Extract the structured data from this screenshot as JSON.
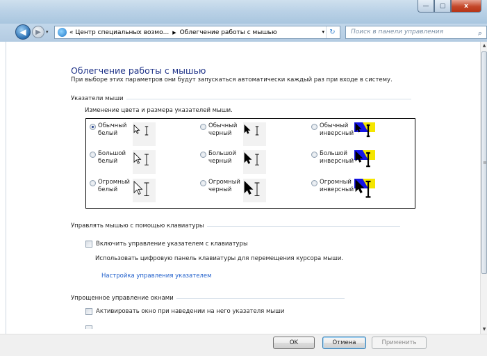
{
  "window": {
    "minimize_glyph": "—",
    "maximize_glyph": "▢",
    "close_glyph": "x"
  },
  "nav": {
    "back_glyph": "◀",
    "forward_glyph": "▶",
    "dropdown_glyph": "▾",
    "breadcrumb_prefix": "«",
    "breadcrumb": [
      "Центр специальных возмо...",
      "Облегчение работы с мышью"
    ],
    "breadcrumb_separator": "▶",
    "address_dropdown_glyph": "▾",
    "refresh_glyph": "↻",
    "search_placeholder": "Поиск в панели управления",
    "search_glyph": "⌕"
  },
  "page": {
    "title": "Облегчение работы с мышью",
    "subtitle": "При выборе этих параметров они будут запускаться автоматически каждый раз при входе в систему."
  },
  "pointers": {
    "section_title": "Указатели мыши",
    "description": "Изменение цвета и размера указателей мыши.",
    "schemes": [
      {
        "line1": "Обычный",
        "line2": "белый",
        "selected": true,
        "style": "white",
        "size": "normal"
      },
      {
        "line1": "Обычный",
        "line2": "черный",
        "selected": false,
        "style": "black",
        "size": "normal"
      },
      {
        "line1": "Обычный",
        "line2": "инверсный",
        "selected": false,
        "style": "invert",
        "size": "normal"
      },
      {
        "line1": "Большой",
        "line2": "белый",
        "selected": false,
        "style": "white",
        "size": "large"
      },
      {
        "line1": "Большой",
        "line2": "черный",
        "selected": false,
        "style": "black",
        "size": "large"
      },
      {
        "line1": "Большой",
        "line2": "инверсный",
        "selected": false,
        "style": "invert",
        "size": "large"
      },
      {
        "line1": "Огромный",
        "line2": "белый",
        "selected": false,
        "style": "white",
        "size": "huge"
      },
      {
        "line1": "Огромный",
        "line2": "черный",
        "selected": false,
        "style": "black",
        "size": "huge"
      },
      {
        "line1": "Огромный",
        "line2": "инверсный",
        "selected": false,
        "style": "invert",
        "size": "huge"
      }
    ]
  },
  "keyboard": {
    "section_title": "Управлять мышью с помощью клавиатуры",
    "checkbox_label": "Включить управление указателем с клавиатуры",
    "checked": false,
    "description": "Использовать цифровую панель клавиатуры для перемещения курсора мыши.",
    "link": "Настройка управления указателем"
  },
  "windows": {
    "section_title": "Упрощенное управление окнами",
    "checkbox_label": "Активировать окно при наведении на него указателя мыши",
    "checked": false
  },
  "footer": {
    "ok": "OK",
    "cancel": "Отмена",
    "apply": "Применить"
  },
  "colors": {
    "title_blue": "#1e3287",
    "link_blue": "#1e5ecb",
    "invert_blue": "#1414e6",
    "invert_yellow": "#f5e600"
  }
}
